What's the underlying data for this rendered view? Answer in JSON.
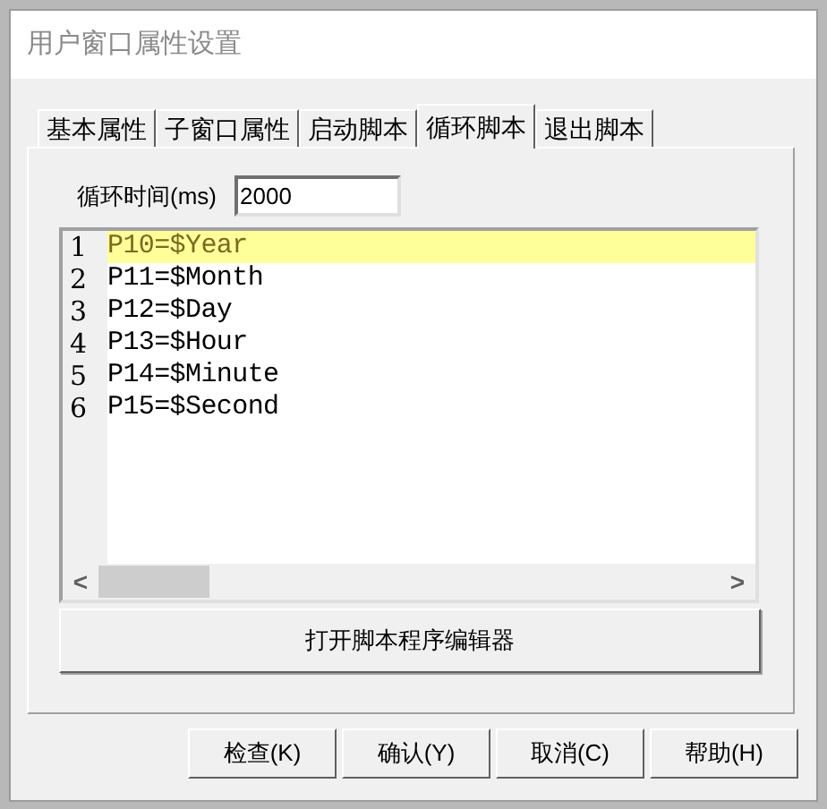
{
  "window": {
    "title": "用户窗口属性设置"
  },
  "tabs": [
    {
      "label": "基本属性",
      "selected": false
    },
    {
      "label": "子窗口属性",
      "selected": false
    },
    {
      "label": "启动脚本",
      "selected": false
    },
    {
      "label": "循环脚本",
      "selected": true
    },
    {
      "label": "退出脚本",
      "selected": false
    }
  ],
  "loop_time": {
    "label": "循环时间(ms)",
    "value": "2000"
  },
  "script_lines": [
    {
      "number": "1",
      "code": "P10=$Year",
      "selected": true
    },
    {
      "number": "2",
      "code": "P11=$Month",
      "selected": false
    },
    {
      "number": "3",
      "code": "P12=$Day",
      "selected": false
    },
    {
      "number": "4",
      "code": "P13=$Hour",
      "selected": false
    },
    {
      "number": "5",
      "code": "P14=$Minute",
      "selected": false
    },
    {
      "number": "6",
      "code": "P15=$Second",
      "selected": false
    }
  ],
  "scroll_left": "<",
  "scroll_right": ">",
  "open_editor_button": "打开脚本程序编辑器",
  "buttons": [
    "检查(K)",
    "确认(Y)",
    "取消(C)",
    "帮助(H)"
  ]
}
